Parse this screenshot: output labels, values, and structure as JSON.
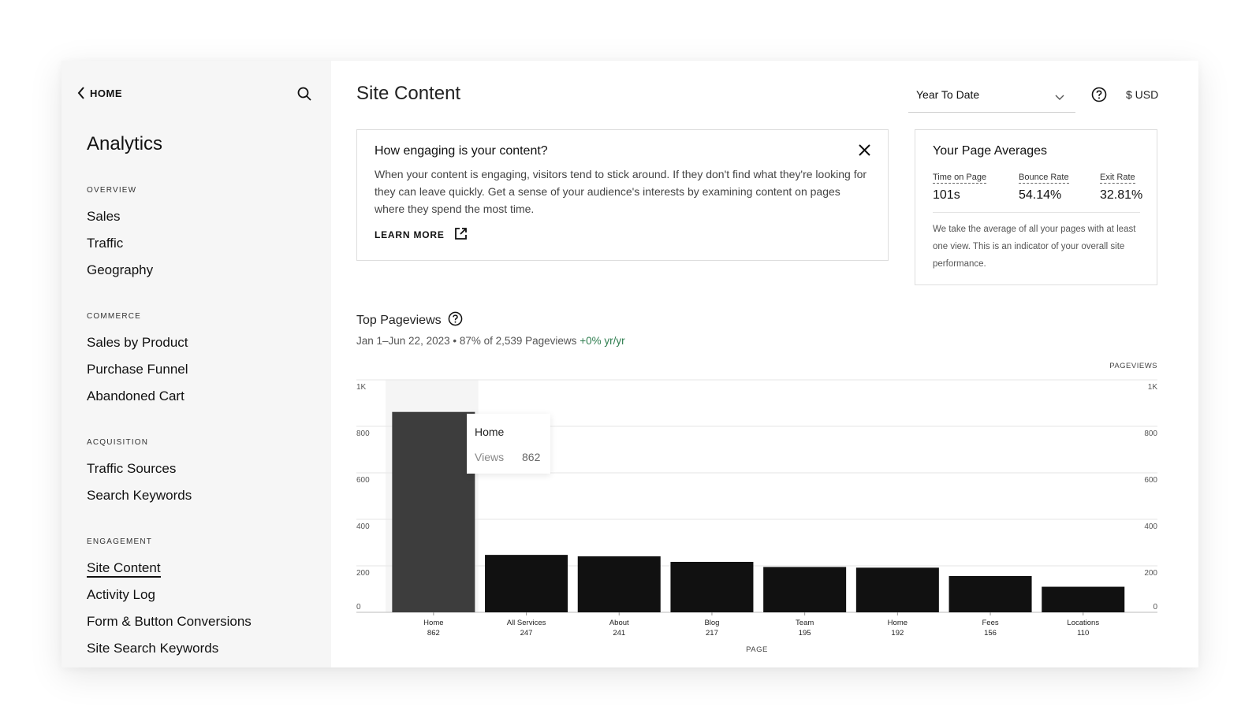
{
  "sidebar": {
    "back_label": "HOME",
    "title": "Analytics",
    "sections": [
      {
        "label": "OVERVIEW",
        "items": [
          "Sales",
          "Traffic",
          "Geography"
        ]
      },
      {
        "label": "COMMERCE",
        "items": [
          "Sales by Product",
          "Purchase Funnel",
          "Abandoned Cart"
        ]
      },
      {
        "label": "ACQUISITION",
        "items": [
          "Traffic Sources",
          "Search Keywords"
        ]
      },
      {
        "label": "ENGAGEMENT",
        "items": [
          "Site Content",
          "Activity Log",
          "Form & Button Conversions",
          "Site Search Keywords"
        ]
      }
    ],
    "active_item": "Site Content"
  },
  "header": {
    "title": "Site Content",
    "range": "Year To Date",
    "currency": "$ USD"
  },
  "info_card": {
    "title": "How engaging is your content?",
    "body": "When your content is engaging, visitors tend to stick around. If they don't find what they're looking for they can leave quickly. Get a sense of your audience's interests by examining content on pages where they spend the most time.",
    "link": "LEARN MORE"
  },
  "averages": {
    "title": "Your Page Averages",
    "metrics": [
      {
        "label": "Time on Page",
        "value": "101s"
      },
      {
        "label": "Bounce Rate",
        "value": "54.14%"
      },
      {
        "label": "Exit Rate",
        "value": "32.81%"
      }
    ],
    "note": "We take the average of all your pages with at least one view. This is an indicator of your overall site performance."
  },
  "top_pageviews": {
    "title": "Top Pageviews",
    "subtitle": "Jan 1–Jun 22, 2023 • 87% of 2,539 Pageviews",
    "growth": "+0% yr/yr"
  },
  "tooltip": {
    "title": "Home",
    "key": "Views",
    "value": "862"
  },
  "chart_data": {
    "type": "bar",
    "categories": [
      "Home",
      "All Services",
      "About",
      "Blog",
      "Team",
      "Home",
      "Fees",
      "Locations"
    ],
    "values": [
      862,
      247,
      241,
      217,
      195,
      192,
      156,
      110
    ],
    "ylabel": "PAGEVIEWS",
    "xlabel": "PAGE",
    "ylim": [
      0,
      1000
    ],
    "yticks": [
      0,
      200,
      400,
      600,
      800,
      1000
    ],
    "ytick_labels": [
      "0",
      "200",
      "400",
      "600",
      "800",
      "1K"
    ],
    "highlighted_index": 0,
    "bar_color": "#111111",
    "highlight_color": "#3d3d3d",
    "grid": true
  }
}
